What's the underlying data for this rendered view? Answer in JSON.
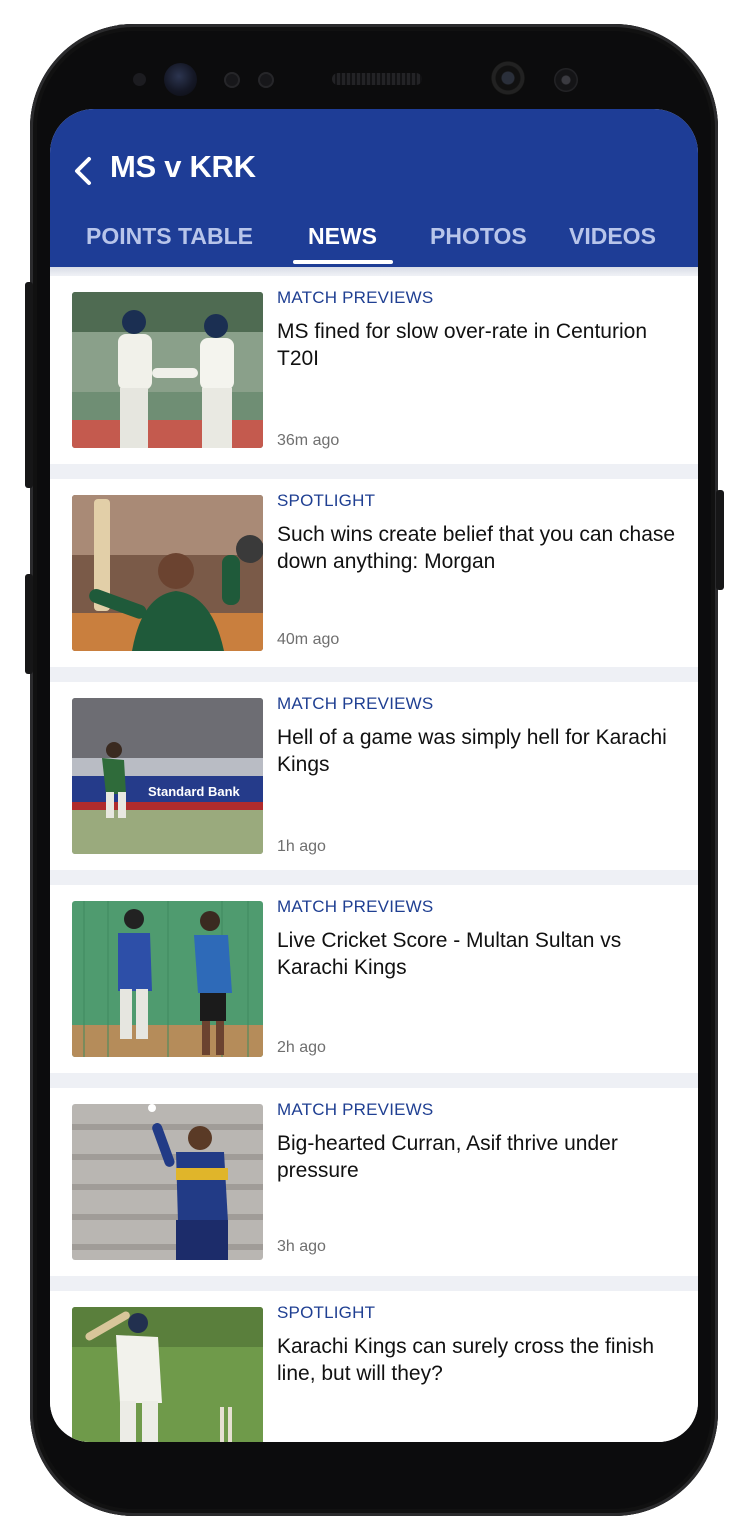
{
  "header": {
    "title": "MS v KRK",
    "back_icon": "chevron-left-icon",
    "background": "#1e3d96"
  },
  "tabs": [
    {
      "label": "POINTS TABLE",
      "active": false
    },
    {
      "label": "NEWS",
      "active": true
    },
    {
      "label": "PHOTOS",
      "active": false
    },
    {
      "label": "VIDEOS",
      "active": false
    }
  ],
  "articles": [
    {
      "category": "MATCH PREVIEWS",
      "headline": "MS fined for slow over-rate in Centurion T20I",
      "time": "36m ago"
    },
    {
      "category": "SPOTLIGHT",
      "headline": "Such wins create belief that you can chase down anything: Morgan",
      "time": "40m ago"
    },
    {
      "category": "MATCH PREVIEWS",
      "headline": "Hell of a game was simply hell for Karachi Kings",
      "time": "1h ago",
      "thumb_banner": "Standard Bank"
    },
    {
      "category": "MATCH PREVIEWS",
      "headline": "Live Cricket Score - Multan Sultan vs Karachi Kings",
      "time": "2h ago"
    },
    {
      "category": "MATCH PREVIEWS",
      "headline": "Big-hearted Curran, Asif thrive under pressure",
      "time": "3h ago"
    },
    {
      "category": "SPOTLIGHT",
      "headline": "Karachi Kings can surely cross the finish line, but will they?",
      "time": ""
    }
  ],
  "colors": {
    "accent": "#1e3d96",
    "category_text": "#1f3f92",
    "tab_inactive": "#b8c5ea",
    "feed_background": "#eef0f5"
  }
}
